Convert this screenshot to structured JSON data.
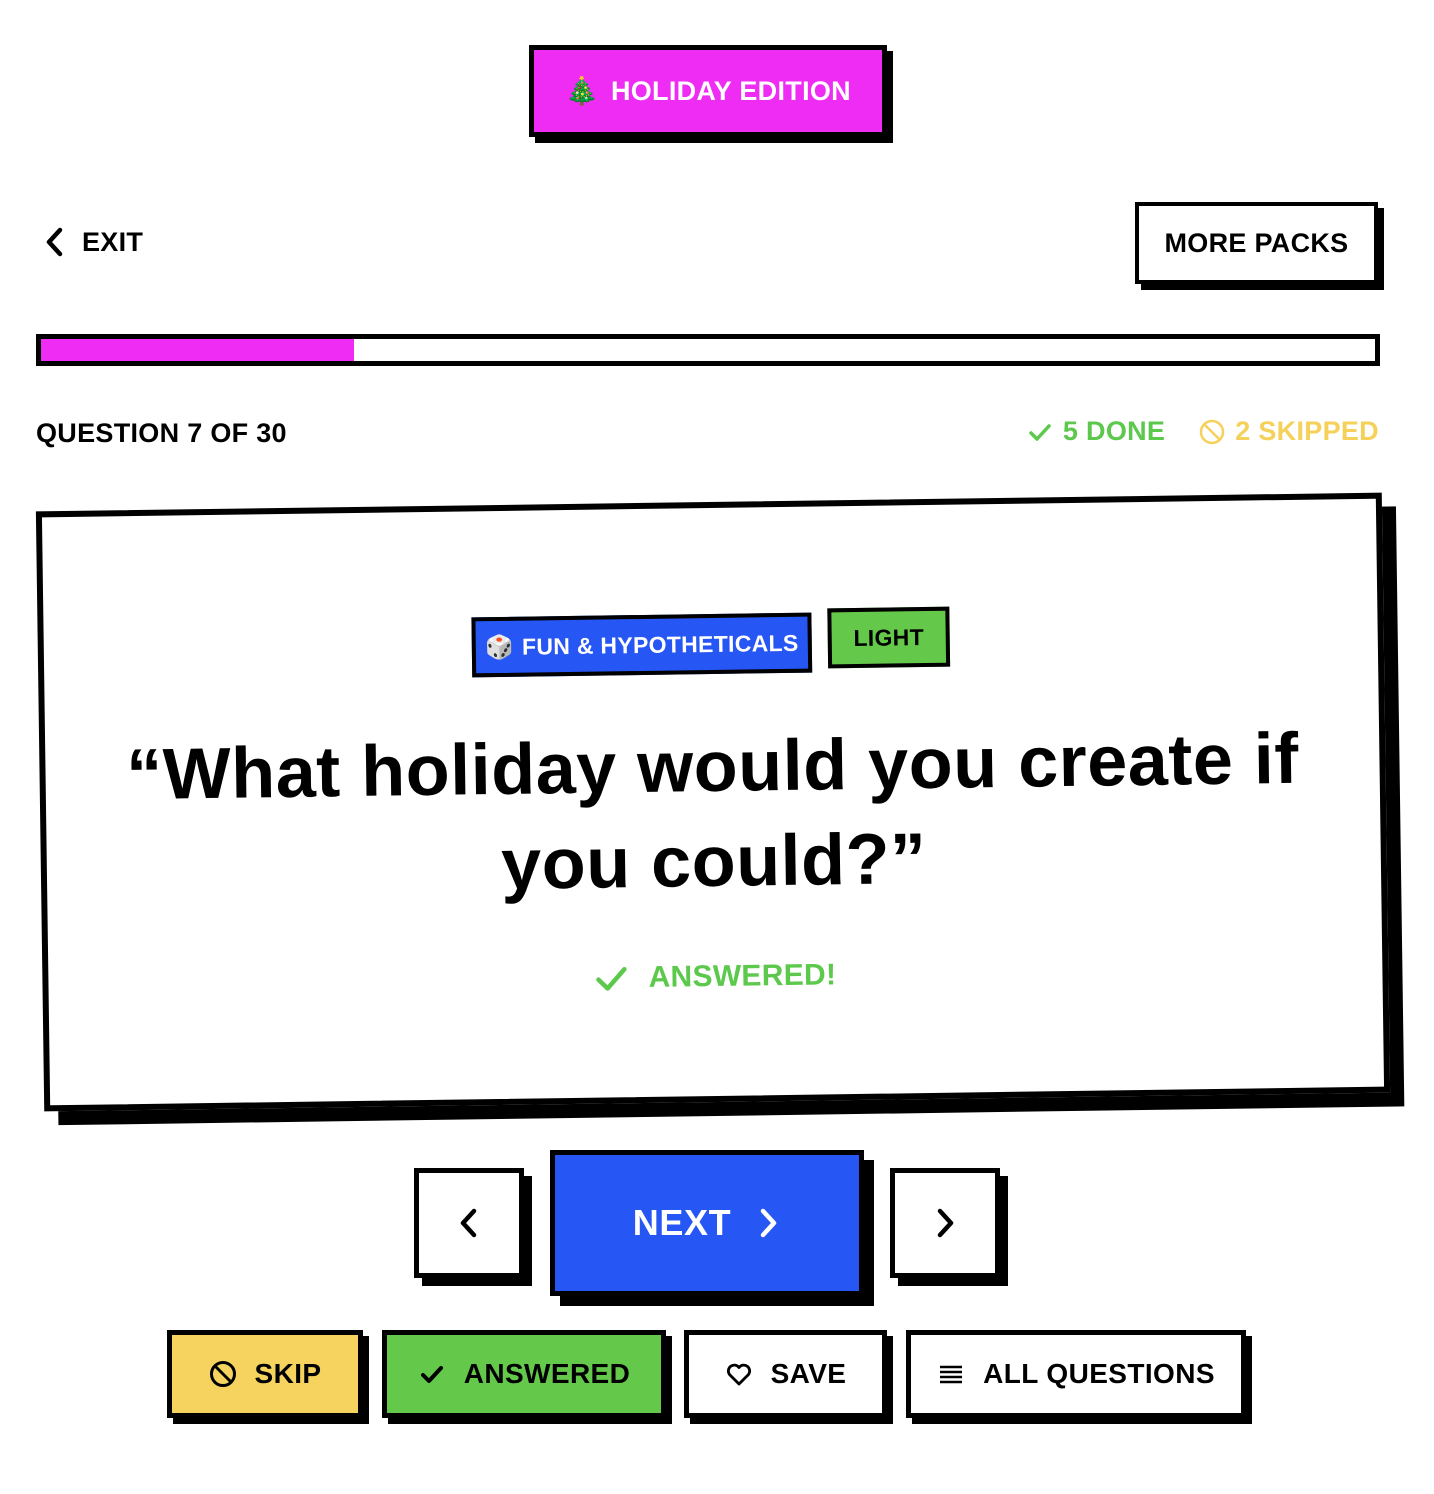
{
  "header": {
    "badge_emoji": "🎄",
    "badge_label": "HOLIDAY EDITION"
  },
  "topbar": {
    "exit_label": "EXIT",
    "more_packs_label": "MORE PACKS"
  },
  "progress": {
    "current": 7,
    "total": 30,
    "fill_fraction": 0.235
  },
  "status": {
    "counter_label": "QUESTION 7 OF 30",
    "done_label": "5 DONE",
    "skipped_label": "2 SKIPPED"
  },
  "card": {
    "category_emoji": "🎲",
    "category_label": "FUN & HYPOTHETICALS",
    "level_label": "LIGHT",
    "question_text": "“What holiday would you create if you could?”",
    "answered_label": "ANSWERED!"
  },
  "navigation": {
    "next_label": "NEXT"
  },
  "actions": {
    "skip_label": "SKIP",
    "answered_label": "ANSWERED",
    "save_label": "SAVE",
    "all_questions_label": "ALL QUESTIONS"
  },
  "colors": {
    "magenta": "#ee2cf4",
    "blue": "#2656f4",
    "green": "#64c84a",
    "done_green": "#5cc84c",
    "yellow": "#f5d35e"
  }
}
